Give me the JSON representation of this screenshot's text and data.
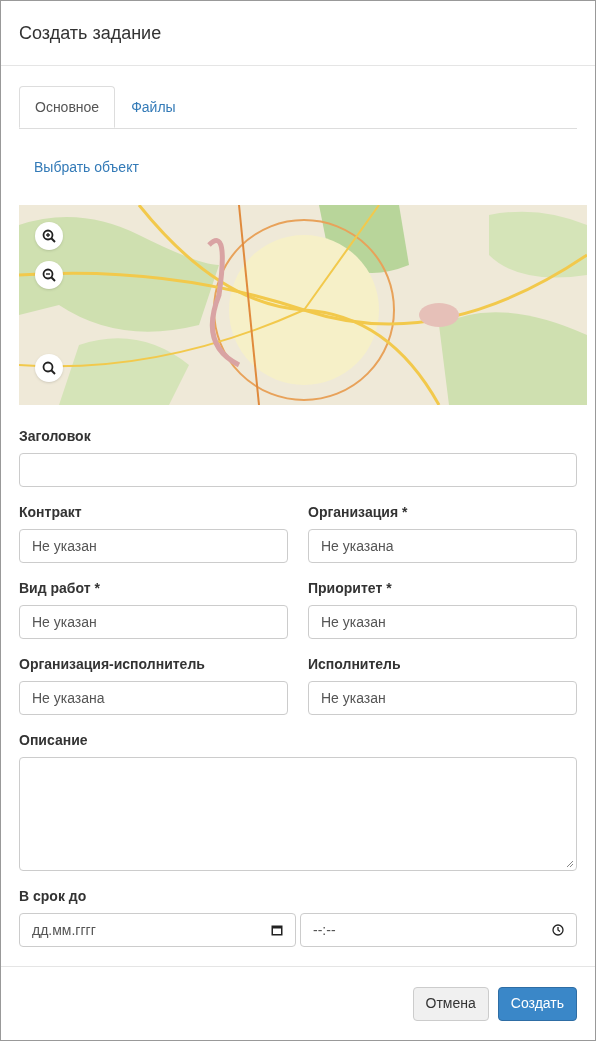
{
  "dialog": {
    "title": "Создать задание"
  },
  "tabs": [
    {
      "label": "Основное",
      "selected": true
    },
    {
      "label": "Файлы",
      "selected": false
    }
  ],
  "select_object_link": "Выбрать объект",
  "rows": [
    [
      {
        "label": "Заголовок",
        "kind": "text"
      }
    ],
    [
      {
        "label": "Контракт",
        "kind": "select",
        "value": "Не указан"
      },
      {
        "label": "Организация *",
        "kind": "select",
        "value": "Не указана"
      }
    ],
    [
      {
        "label": "Вид работ *",
        "kind": "select",
        "value": "Не указан"
      },
      {
        "label": "Приоритет *",
        "kind": "select",
        "value": "Не указан"
      }
    ],
    [
      {
        "label": "Организация-исполнитель",
        "kind": "select",
        "value": "Не указана"
      },
      {
        "label": "Исполнитель",
        "kind": "select",
        "value": "Не указан"
      }
    ],
    [
      {
        "label": "Описание",
        "kind": "textarea"
      }
    ],
    [
      {
        "label": "В срок до",
        "kind": "datetime",
        "date_placeholder": "дд.мм.гггг",
        "time_placeholder": "--:--"
      }
    ]
  ],
  "buttons": [
    {
      "label": "Отмена",
      "kind": "secondary"
    },
    {
      "label": "Создать",
      "kind": "primary"
    }
  ]
}
